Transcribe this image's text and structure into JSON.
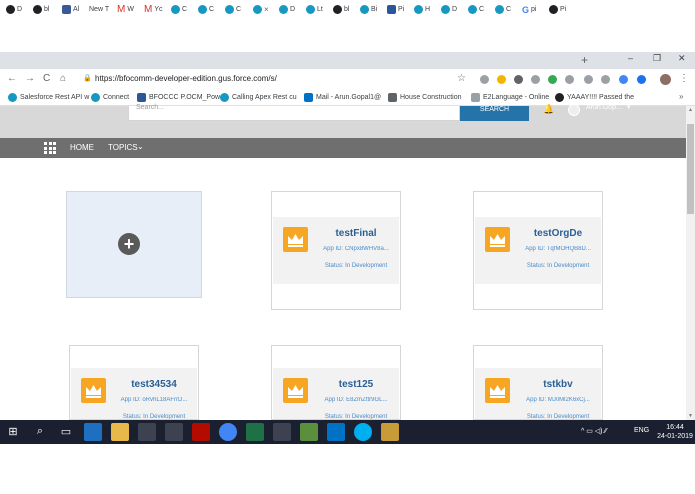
{
  "browser": {
    "tabs": [
      {
        "label": "D",
        "color": "#202124"
      },
      {
        "label": "bl",
        "color": "#202124"
      },
      {
        "label": "Al",
        "color": "#3b5998"
      },
      {
        "label": "New T",
        "color": "#9aa0a6"
      },
      {
        "label": "W",
        "color": "#d93025"
      },
      {
        "label": "Yc",
        "color": "#d93025"
      },
      {
        "label": "C",
        "color": "#1798c1"
      },
      {
        "label": "C",
        "color": "#1798c1"
      },
      {
        "label": "C",
        "color": "#1798c1"
      },
      {
        "label": "D",
        "color": "#1798c1"
      },
      {
        "label": "Lt",
        "color": "#1798c1"
      },
      {
        "label": "bl",
        "color": "#202124"
      },
      {
        "label": "Bi",
        "color": "#1798c1"
      },
      {
        "label": "Pi",
        "color": "#2b579a"
      },
      {
        "label": "H",
        "color": "#1798c1"
      },
      {
        "label": "D",
        "color": "#1798c1"
      },
      {
        "label": "C",
        "color": "#1798c1"
      },
      {
        "label": "C",
        "color": "#1798c1"
      },
      {
        "label": "pi",
        "color": "#4285f4"
      },
      {
        "label": "Pi",
        "color": "#202124"
      }
    ],
    "active_tab_close": "×",
    "new_tab": "+",
    "window_controls": {
      "minimize": "–",
      "maximize": "❐",
      "close": "✕"
    },
    "nav": {
      "back": "←",
      "forward": "→",
      "reload": "C",
      "home": "⌂"
    },
    "url": "https://bfocomm-developer-edition.gus.force.com/s/",
    "bookmarks": [
      {
        "label": "Salesforce Rest API w",
        "color": "#1798c1"
      },
      {
        "label": "Connect",
        "color": "#1798c1"
      },
      {
        "label": "BFOCCC P.OCM_Pow",
        "color": "#2b579a"
      },
      {
        "label": "Calling Apex Rest cu",
        "color": "#1798c1"
      },
      {
        "label": "Mail - Arun.Gopal1@",
        "color": "#0072c6"
      },
      {
        "label": "House Construction",
        "color": "#5f6368"
      },
      {
        "label": "E2Language - Online",
        "color": "#5f6368"
      },
      {
        "label": "YAAAY!!!! Passed the",
        "color": "#202124"
      }
    ],
    "bookmarks_more": "»",
    "extension_colors": [
      "#9aa0a6",
      "#f4b400",
      "#5f6368",
      "#9aa0a6",
      "#34a853",
      "#9aa0a6",
      "#9aa0a6",
      "#9aa0a6",
      "#4285f4",
      "#1a73e8"
    ]
  },
  "site": {
    "search": {
      "placeholder": "Search...",
      "button_label": "SEARCH"
    },
    "user": {
      "name": "Arun.Gop...",
      "caret": "▾",
      "bell": "🔔"
    },
    "nav": {
      "home_label": "HOME",
      "topics_label": "TOPICS",
      "topics_caret": "⌄"
    }
  },
  "cards": [
    {
      "title": "testFinal",
      "app_id": "App ID: CNpx8WHV8a...",
      "status": "Status: In Development"
    },
    {
      "title": "testOrgDe",
      "app_id": "App ID: TqfMOHQB8D...",
      "status": "Status: In Development"
    },
    {
      "title": "test34534",
      "app_id": "App ID: oRvhL18AFrrD...",
      "status": "Status: In Development"
    },
    {
      "title": "test125",
      "app_id": "App ID: E8ZmZttr9GL...",
      "status": "Status: In Development"
    },
    {
      "title": "tstkbv",
      "app_id": "App ID: MJ0Ml2K6xCj...",
      "status": "Status: In Development"
    }
  ],
  "add_card": {
    "icon": "+"
  },
  "taskbar": {
    "time": "16:44",
    "date": "24-01-2019",
    "language": "ENG",
    "tray": "^  ▭  ◁)  ⁄⁄"
  }
}
